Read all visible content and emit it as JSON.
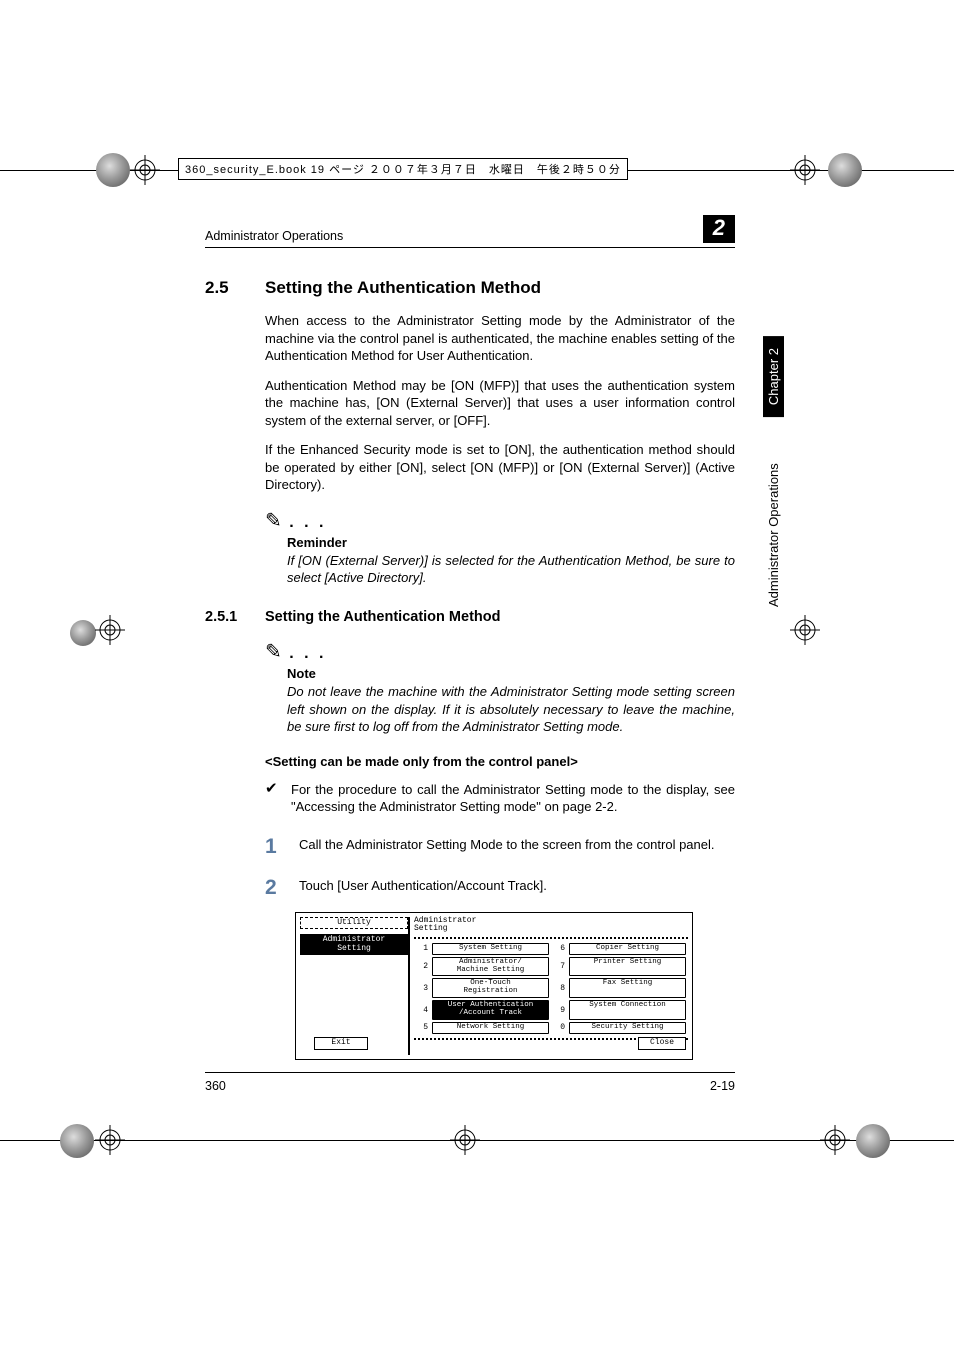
{
  "print_header": "360_security_E.book  19 ページ  ２００７年３月７日　水曜日　午後２時５０分",
  "running_head": "Administrator Operations",
  "chapter_num": "2",
  "side_chapter": "Chapter 2",
  "side_section": "Administrator Operations",
  "section": {
    "num": "2.5",
    "title": "Setting the Authentication Method"
  },
  "paras": {
    "p1": "When access to the Administrator Setting mode by the Administrator of the machine via the control panel is authenticated, the machine enables setting of the Authentication Method for User Authentication.",
    "p2": "Authentication Method may be [ON (MFP)] that uses the authentication system the machine has, [ON (External Server)] that uses a user information control system of the external server, or [OFF].",
    "p3": "If the Enhanced Security mode is set to [ON], the authentication method should be operated by either [ON], select [ON (MFP)] or [ON (External Server)] (Active Directory)."
  },
  "reminder": {
    "label": "Reminder",
    "body": "If [ON (External Server)] is selected for the Authentication Method, be sure to select [Active Directory]."
  },
  "subsection": {
    "num": "2.5.1",
    "title": "Setting the Authentication Method"
  },
  "note": {
    "label": "Note",
    "body": "Do not leave the machine with the Administrator Setting mode setting screen left shown on the display. If it is absolutely necessary to leave the machine, be sure first to log off from the Administrator Setting mode."
  },
  "bold_hint": "<Setting can be made only from the control panel>",
  "check_item": "For the procedure to call the Administrator Setting mode to the display, see \"Accessing the Administrator Setting mode\" on page 2-2.",
  "steps": {
    "s1": "Call the Administrator Setting Mode to the screen from the control panel.",
    "s2": "Touch [User Authentication/Account Track]."
  },
  "panel": {
    "utility": "Utility",
    "admin_setting": "Administrator\nSetting",
    "exit": "Exit",
    "header": "Administrator\nSetting",
    "close": "Close",
    "items": [
      {
        "n": "1",
        "label": "System Setting"
      },
      {
        "n": "2",
        "label": "Administrator/\nMachine Setting"
      },
      {
        "n": "3",
        "label": "One-Touch\nRegistration"
      },
      {
        "n": "4",
        "label": "User Authentication\n/Account Track",
        "hi": true
      },
      {
        "n": "5",
        "label": "Network Setting"
      },
      {
        "n": "6",
        "label": "Copier Setting"
      },
      {
        "n": "7",
        "label": "Printer Setting"
      },
      {
        "n": "8",
        "label": "Fax Setting"
      },
      {
        "n": "9",
        "label": "System Connection"
      },
      {
        "n": "0",
        "label": "Security Setting"
      }
    ]
  },
  "footer": {
    "left": "360",
    "right": "2-19"
  }
}
